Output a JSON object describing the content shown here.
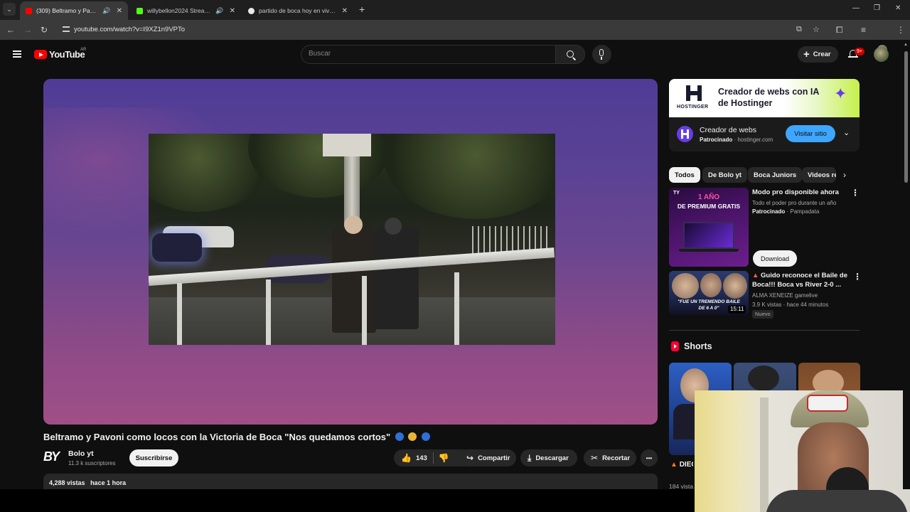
{
  "browser": {
    "tabs": [
      {
        "title": "(309) Beltramo y Pavoni con",
        "favicon_color": "#ff0000",
        "active": true
      },
      {
        "title": "willybellon2024 Stream - W",
        "favicon_color": "#53fc18",
        "active": false
      },
      {
        "title": "partido de boca hoy en vivo - B",
        "favicon_color": "#e8eaed",
        "active": false
      }
    ],
    "new_tab": "+",
    "url": "youtube.com/watch?v=I9XZ1n9VPTo"
  },
  "header": {
    "logo_text": "YouTube",
    "country_code": "AR",
    "search_placeholder": "Buscar",
    "create_label": "Crear",
    "notifications_badge": "9+"
  },
  "video": {
    "title": "Beltramo y Pavoni como locos con la Victoria de Boca \"Nos quedamos cortos\"",
    "title_emojis": [
      "blue-circle",
      "yellow-circle",
      "blue-circle"
    ],
    "channel_logo": "BY",
    "channel_name": "Bolo yt",
    "subscribers": "11.3 k suscriptores",
    "subscribe_label": "Suscribirse",
    "likes": "143",
    "share_label": "Compartir",
    "download_label": "Descargar",
    "clip_label": "Recortar",
    "more_label": "•••",
    "views": "4,288 vistas",
    "uploaded": "hace 1 hora"
  },
  "sidebar": {
    "ad": {
      "banner_headline": "Creador de webs con IA de Hostinger",
      "brand_logo_text": "HOSTINGER",
      "title": "Creador de webs",
      "sponsored_label": "Patrocinado",
      "domain": "hostinger.com",
      "visit_label": "Visitar sitio"
    },
    "chips": [
      "Todos",
      "De Bolo yt",
      "Boca Juniors",
      "Videos re"
    ],
    "recommendations": [
      {
        "title": "Modo pro disponible ahora",
        "line1": "Todo el poder pro durante un año",
        "sponsored_label": "Patrocinado",
        "advertiser": "Pampadata",
        "cta": "Download",
        "thumb_text_1": "1 AÑO",
        "thumb_text_2": "DE PREMIUM GRATIS"
      },
      {
        "title": "Guido reconoce el Baile de Boca!!! Boca vs River 2-0 ...",
        "channel": "ALMA XENEIZE gamelive",
        "views": "3.9 K vistas",
        "age": "hace 44 minutos",
        "badge": "Nuevo",
        "duration": "15:11",
        "thumb_text_1": "\"FUE UN TREMENDO BAILE",
        "thumb_text_2": "DE 6 A 0\""
      }
    ],
    "shorts": {
      "heading": "Shorts",
      "first_title": "DIEG DÍAZ: \"F",
      "first_views": "184 vista"
    }
  },
  "colors": {
    "background": "#0f0f0f",
    "youtube_red": "#ff0000",
    "hostinger_purple": "#673de6",
    "visit_blue": "#3ea6ff"
  }
}
